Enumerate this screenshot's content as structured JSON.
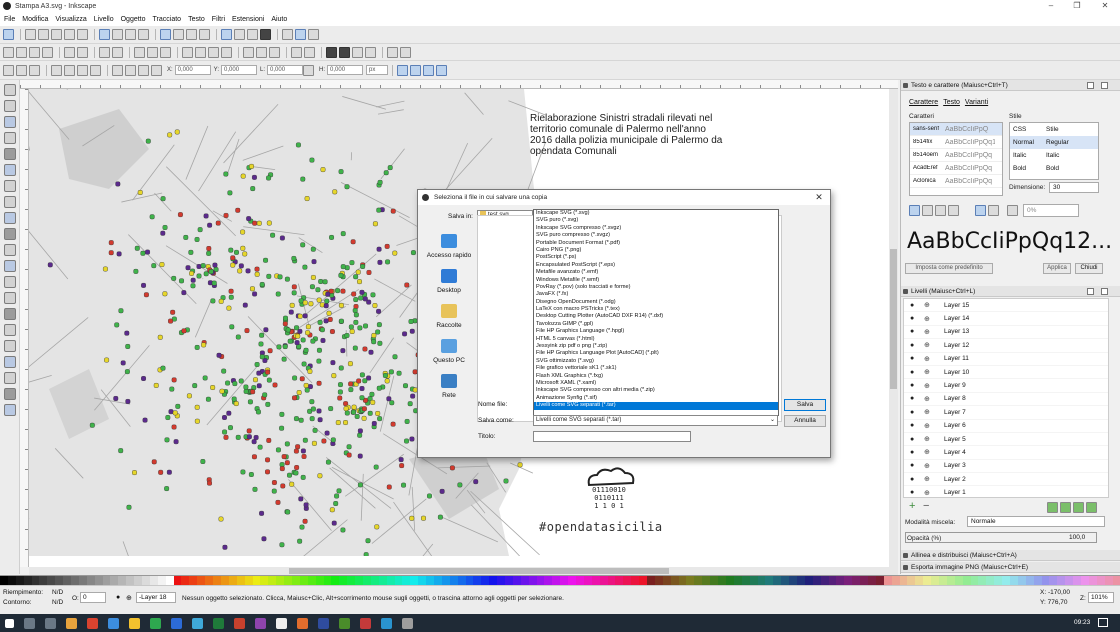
{
  "window": {
    "title": "Stampa A3.svg - Inkscape",
    "minimize": "–",
    "maximize": "❐",
    "close": "✕"
  },
  "menu": [
    "File",
    "Modifica",
    "Visualizza",
    "Livello",
    "Oggetto",
    "Tracciato",
    "Testo",
    "Filtri",
    "Estensioni",
    "Aiuto"
  ],
  "coords": {
    "x_label": "X:",
    "x": "0,000",
    "y_label": "Y:",
    "y": "0,000",
    "w_label": "L:",
    "w": "0,000",
    "h_label": "H:",
    "h": "0,000",
    "unit": "px"
  },
  "page": {
    "description_text": "Rielaborazione Sinistri stradali rilevati nel territorio comunale di Palermo nell'anno 2016 dalla polizia municipale di Palermo da opendata Comunali",
    "hashtag": "#opendatasicilia",
    "logo_binary": [
      "01110010",
      "0110111",
      "1  1 0 1"
    ]
  },
  "text_panel": {
    "title": "Testo e carattere (Maiusc+Ctrl+T)",
    "tabs": [
      "Carattere",
      "Testo",
      "Varianti"
    ],
    "font_group_label": "Caratteri",
    "style_group_label": "Stile",
    "fonts": [
      {
        "name": "sans-serif",
        "preview": "AaBbCcIiPpQ"
      },
      {
        "name": "8514fix",
        "preview": "AaBbCcIiPpQq12"
      },
      {
        "name": "8514oem",
        "preview": "AaBbCcIiPpQq"
      },
      {
        "name": "AcadEref",
        "preview": "AaBbCcIiPpQq"
      },
      {
        "name": "Aclonica",
        "preview": "AaBbCcIiPpQq"
      }
    ],
    "styles_header": {
      "css": "CSS",
      "face": "Stile"
    },
    "styles": [
      {
        "css": "Normal",
        "face": "Regular"
      },
      {
        "css": "Italic",
        "face": "Italic"
      },
      {
        "css": "Bold",
        "face": "Bold"
      }
    ],
    "size_label": "Dimensione:",
    "size_value": "30",
    "spacing_value": "0%",
    "preview_text": "AaBbCcIiPpQq12...",
    "set_default_button": "Imposta come predefinito",
    "apply_button": "Applica",
    "close_button": "Chiudi"
  },
  "layers_panel": {
    "title": "Livelli (Maiusc+Ctrl+L)",
    "layers": [
      "Layer 15",
      "Layer 14",
      "Layer 13",
      "Layer 12",
      "Layer 11",
      "Layer 10",
      "Layer 9",
      "Layer 8",
      "Layer 7",
      "Layer 6",
      "Layer 5",
      "Layer 4",
      "Layer 3",
      "Layer 2",
      "Layer 1"
    ],
    "blend_label": "Modalità miscela:",
    "blend_value": "Normale",
    "opacity_label": "Opacità (%)",
    "opacity_value": "100,0",
    "add_icon": "+",
    "remove_icon": "−"
  },
  "collapsed_panels": [
    "Allinea e distribuisci (Maiusc+Ctrl+A)",
    "Esporta immagine PNG (Maiusc+Ctrl+E)"
  ],
  "status": {
    "fill_label": "Riempimento:",
    "fill_value": "N/D",
    "stroke_label": "Contorno:",
    "stroke_value": "N/D",
    "opacity_label": "O:",
    "opacity_value": "0",
    "layer_value": "-Layer 18",
    "message": "Nessun oggetto selezionato. Clicca, Maiusc+Clic, Alt+scorrimento mouse sugli oggetti, o trascina attorno agli oggetti per selezionare.",
    "x_readout": "X: -170,00",
    "y_readout": "Y:  776,70",
    "zoom_label": "Z:",
    "zoom_value": "101%"
  },
  "dialog": {
    "title": "Seleziona il file in cui salvare una copia",
    "save_in_label": "Salva in:",
    "folder": "test svg",
    "places": [
      "Accesso rapido",
      "Desktop",
      "Raccolte",
      "Questo PC",
      "Rete"
    ],
    "formats": [
      "Inkscape SVG (*.svg)",
      "SVG puro (*.svg)",
      "Inkscape SVG compresso (*.svgz)",
      "SVG puro compresso (*.svgz)",
      "Portable Document Format (*.pdf)",
      "Cairo PNG (*.png)",
      "PostScript (*.ps)",
      "Encapsulated PostScript (*.eps)",
      "Metafile avanzato (*.emf)",
      "Windows Metafile (*.wmf)",
      "PovRay (*.pov) (solo tracciati e forme)",
      "JavaFX (*.fx)",
      "Disegno OpenDocument (*.odg)",
      "LaTeX con macro PSTricks (*.tex)",
      "Desktop Cutting Plotter (AutoCAD DXF R14) (*.dxf)",
      "Tavolozza GIMP (*.gpl)",
      "File HP Graphics Language (*.hpgl)",
      "HTML 5 canvas (*.html)",
      "Jessyink zip pdf o png (*.zip)",
      "File HP Graphics Language Plot [AutoCAD] (*.plt)",
      "SVG ottimizzato (*.svg)",
      "File grafico vettoriale sK1 (*.sk1)",
      "Flash XML Graphics (*.fxg)",
      "Microsoft XAML (*.xaml)",
      "Inkscape SVG compresso con altri media (*.zip)",
      "Animazione Synfig (*.sif)",
      "Livelli come SVG separati (*.tar)"
    ],
    "selected_format_index": 26,
    "filename_label": "Nome file:",
    "save_as_label": "Salva come:",
    "save_as_value": "Livelli come SVG separati (*.tar)",
    "title_label": "Titolo:",
    "save_button": "Salva",
    "cancel_button": "Annulla"
  },
  "taskbar": {
    "time": "09:23"
  },
  "colors": {
    "selection_blue": "#0078d7",
    "map_point_green": "#3fb24a",
    "map_point_red": "#d23a2e",
    "map_point_yellow": "#e6d62a",
    "map_point_purple": "#5b2a8c"
  }
}
